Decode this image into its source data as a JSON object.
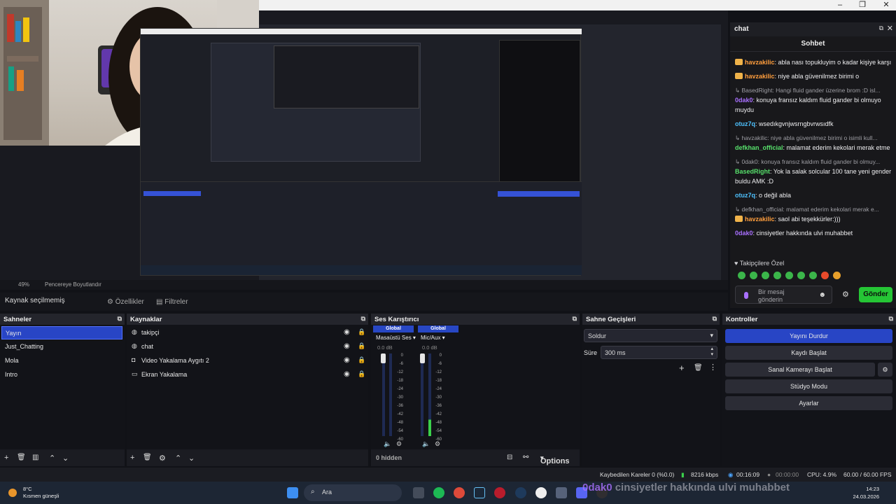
{
  "titlebar": {
    "minimize": "–",
    "maximize": "❐",
    "close": "✕"
  },
  "preview": {
    "zoom": "49%",
    "resize_label": "Pencereye Boyutlandır"
  },
  "sourcebar": {
    "no_source": "Kaynak seçilmemiş",
    "properties": "Özellikler",
    "filters": "Filtreler"
  },
  "chat": {
    "dock_title": "chat",
    "title": "Sohbet",
    "messages": [
      {
        "type": "msg",
        "user": "havzakilic",
        "color": "#ff9e3d",
        "badge": true,
        "text": ": abla nası topukluyim o kadar kişiye karşı"
      },
      {
        "type": "msg",
        "user": "havzakilic",
        "color": "#ff9e3d",
        "badge": true,
        "text": ": niye abla güvenilmez birimi o"
      },
      {
        "type": "reply",
        "text": "↳ BasedRight: Hangi fluid gander üzerine brom :D isl..."
      },
      {
        "type": "msg",
        "user": "0dak0",
        "color": "#a970ff",
        "badge": false,
        "text": ": konuya fransız kaldım fluid gander bi olmuyo muydu"
      },
      {
        "type": "msg",
        "user": "otuz7q",
        "color": "#4ec2ff",
        "badge": false,
        "text": ": wsedıkgvnjwsrngbvrwsıdfk"
      },
      {
        "type": "reply",
        "text": "↳ havzakilic: niye abla güvenilmez birimi o isimli kull..."
      },
      {
        "type": "msg",
        "user": "defkhan_official",
        "color": "#57e06b",
        "badge": false,
        "text": ": malamat ederim kekolari merak etme"
      },
      {
        "type": "reply",
        "text": "↳ 0dak0: konuya fransız kaldım fluid gander bi olmuy..."
      },
      {
        "type": "msg",
        "user": "BasedRight",
        "color": "#57e06b",
        "badge": false,
        "text": ": Yok la salak solcular 100 tane yeni gender buldu AMK :D"
      },
      {
        "type": "msg",
        "user": "otuz7q",
        "color": "#4ec2ff",
        "badge": false,
        "text": ": o değil abla"
      },
      {
        "type": "reply",
        "text": "↳ defkhan_official: malamat ederim kekolari merak e..."
      },
      {
        "type": "msg",
        "user": "havzakilic",
        "color": "#ff9e3d",
        "badge": true,
        "text": ": saol abi teşekkürler:)))"
      },
      {
        "type": "msg",
        "user": "0dak0",
        "color": "#a970ff",
        "badge": false,
        "text": ": cinsiyetler hakkında ulvi muhabbet"
      }
    ],
    "pinned": "Takipçilere Özel",
    "input_placeholder": "Bir mesaj gönderin",
    "send": "Gönder"
  },
  "scenes": {
    "title": "Sahneler",
    "items": [
      "Yayın",
      "Just_Chatting",
      "Mola",
      "Intro"
    ]
  },
  "sources": {
    "title": "Kaynaklar",
    "items": [
      "takipçi",
      "chat",
      "Video Yakalama Aygıtı 2",
      "Ekran Yakalama"
    ]
  },
  "mixer": {
    "title": "Ses Karıştırıcı",
    "channels": [
      {
        "global": "Global",
        "name": "Masaüstü Ses",
        "db": "0.0 dB"
      },
      {
        "global": "Global",
        "name": "Mic/Aux",
        "db": "0.0 dB"
      }
    ],
    "scale": [
      "0",
      "-6",
      "-12",
      "-18",
      "-24",
      "-30",
      "-36",
      "-42",
      "-48",
      "-54",
      "-60"
    ],
    "hidden": "0 hidden",
    "options": "Options"
  },
  "transitions": {
    "title": "Sahne Geçişleri",
    "selected": "Soldur",
    "duration_label": "Süre",
    "duration": "300 ms"
  },
  "controls": {
    "title": "Kontroller",
    "stop_stream": "Yayını Durdur",
    "start_rec": "Kaydı Başlat",
    "virtual_cam": "Sanal Kamerayı Başlat",
    "studio": "Stüdyo Modu",
    "settings": "Ayarlar"
  },
  "status": {
    "dropped": "Kaybedilen Kareler 0 (%0.0)",
    "bitrate": "8216 kbps",
    "stream_time": "00:16:09",
    "rec_time": "00:00:00",
    "cpu": "CPU: 4.9%",
    "fps": "60.00 / 60.00 FPS"
  },
  "taskbar": {
    "temp": "8°C",
    "weather": "Kısmen güneşli",
    "search": "Ara",
    "time": "14:23",
    "date": "24.03.2026",
    "overlay_name": "0dak0",
    "overlay_text": "cinsiyetler hakkında ulvi muhabbet"
  }
}
